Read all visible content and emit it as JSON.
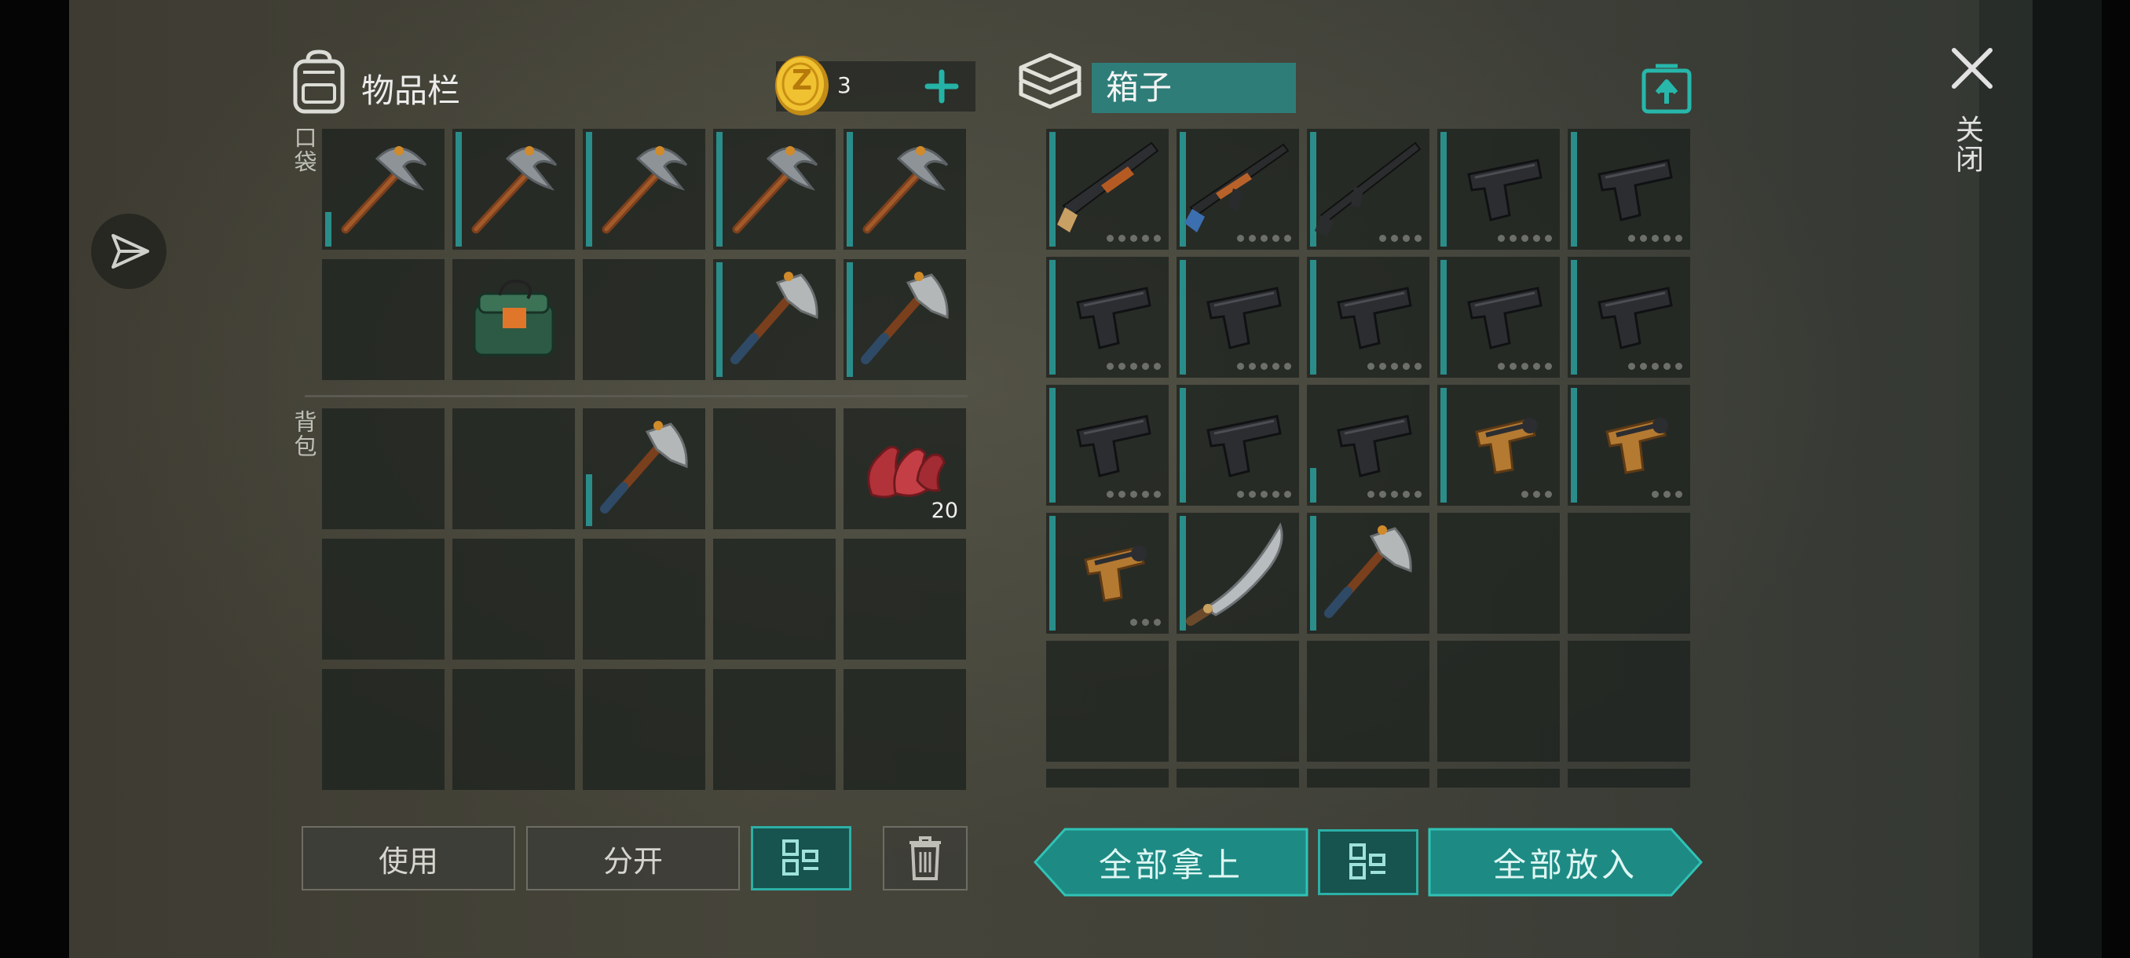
{
  "inventory": {
    "title": "物品栏",
    "coins": "3",
    "coin_symbol": "Z",
    "pocket_label": "口袋",
    "backpack_label": "背包",
    "pocket_slots": [
      {
        "icon": "pickaxe-icon",
        "fill": 0.3
      },
      {
        "icon": "pickaxe-icon",
        "fill": 1
      },
      {
        "icon": "pickaxe-icon",
        "fill": 1
      },
      {
        "icon": "pickaxe-icon",
        "fill": 1
      },
      {
        "icon": "pickaxe-icon",
        "fill": 1
      },
      {
        "icon": "",
        "fill": 0
      },
      {
        "icon": "explosive-charge-icon",
        "fill": 0
      },
      {
        "icon": "",
        "fill": 0
      },
      {
        "icon": "hatchet-icon",
        "fill": 1
      },
      {
        "icon": "hatchet-icon",
        "fill": 1
      }
    ],
    "backpack_slots": [
      {
        "icon": "",
        "fill": 0
      },
      {
        "icon": "",
        "fill": 0
      },
      {
        "icon": "hatchet-icon",
        "fill": 0.45
      },
      {
        "icon": "",
        "fill": 0
      },
      {
        "icon": "raw-meat-icon",
        "fill": 0,
        "qty": "20"
      },
      {
        "icon": "",
        "fill": 0
      },
      {
        "icon": "",
        "fill": 0
      },
      {
        "icon": "",
        "fill": 0
      },
      {
        "icon": "",
        "fill": 0
      },
      {
        "icon": "",
        "fill": 0
      },
      {
        "icon": "",
        "fill": 0
      },
      {
        "icon": "",
        "fill": 0
      },
      {
        "icon": "",
        "fill": 0
      },
      {
        "icon": "",
        "fill": 0
      },
      {
        "icon": "",
        "fill": 0
      }
    ],
    "use_label": "使用",
    "split_label": "分开"
  },
  "box": {
    "title": "箱子",
    "slots": [
      {
        "icon": "shotgun-icon",
        "fill": 1,
        "dots": 5
      },
      {
        "icon": "assault-rifle-icon",
        "fill": 1,
        "dots": 5
      },
      {
        "icon": "m16-rifle-icon",
        "fill": 1,
        "dots": 4
      },
      {
        "icon": "pistol-icon",
        "fill": 1,
        "dots": 5
      },
      {
        "icon": "pistol-icon",
        "fill": 1,
        "dots": 5
      },
      {
        "icon": "pistol-icon",
        "fill": 1,
        "dots": 5
      },
      {
        "icon": "pistol-icon",
        "fill": 1,
        "dots": 5
      },
      {
        "icon": "pistol-icon",
        "fill": 1,
        "dots": 5
      },
      {
        "icon": "pistol-icon",
        "fill": 1,
        "dots": 5
      },
      {
        "icon": "pistol-icon",
        "fill": 1,
        "dots": 5
      },
      {
        "icon": "pistol-icon",
        "fill": 1,
        "dots": 5
      },
      {
        "icon": "pistol-icon",
        "fill": 1,
        "dots": 5
      },
      {
        "icon": "pistol-icon",
        "fill": 0.3,
        "dots": 5
      },
      {
        "icon": "flare-gun-icon",
        "fill": 1,
        "dots": 3
      },
      {
        "icon": "flare-gun-icon",
        "fill": 1,
        "dots": 3
      },
      {
        "icon": "flare-gun-icon",
        "fill": 1,
        "dots": 3
      },
      {
        "icon": "machete-icon",
        "fill": 1,
        "dots": 0
      },
      {
        "icon": "hatchet-icon",
        "fill": 1,
        "dots": 0
      },
      {
        "icon": "",
        "fill": 0,
        "dots": 0
      },
      {
        "icon": "",
        "fill": 0,
        "dots": 0
      },
      {
        "icon": "",
        "fill": 0,
        "dots": 0
      },
      {
        "icon": "",
        "fill": 0,
        "dots": 0
      },
      {
        "icon": "",
        "fill": 0,
        "dots": 0
      },
      {
        "icon": "",
        "fill": 0,
        "dots": 0
      },
      {
        "icon": "",
        "fill": 0,
        "dots": 0
      },
      {
        "icon": "",
        "fill": 0,
        "dots": 0
      },
      {
        "icon": "",
        "fill": 0,
        "dots": 0
      },
      {
        "icon": "",
        "fill": 0,
        "dots": 0
      },
      {
        "icon": "",
        "fill": 0,
        "dots": 0
      },
      {
        "icon": "",
        "fill": 0,
        "dots": 0
      }
    ],
    "take_all_label": "全部拿上",
    "put_all_label": "全部放入"
  },
  "close_label": "关闭",
  "colors": {
    "accent": "#2cb0a6",
    "accent_dark": "#17534f",
    "coin": "#e9b82c"
  }
}
